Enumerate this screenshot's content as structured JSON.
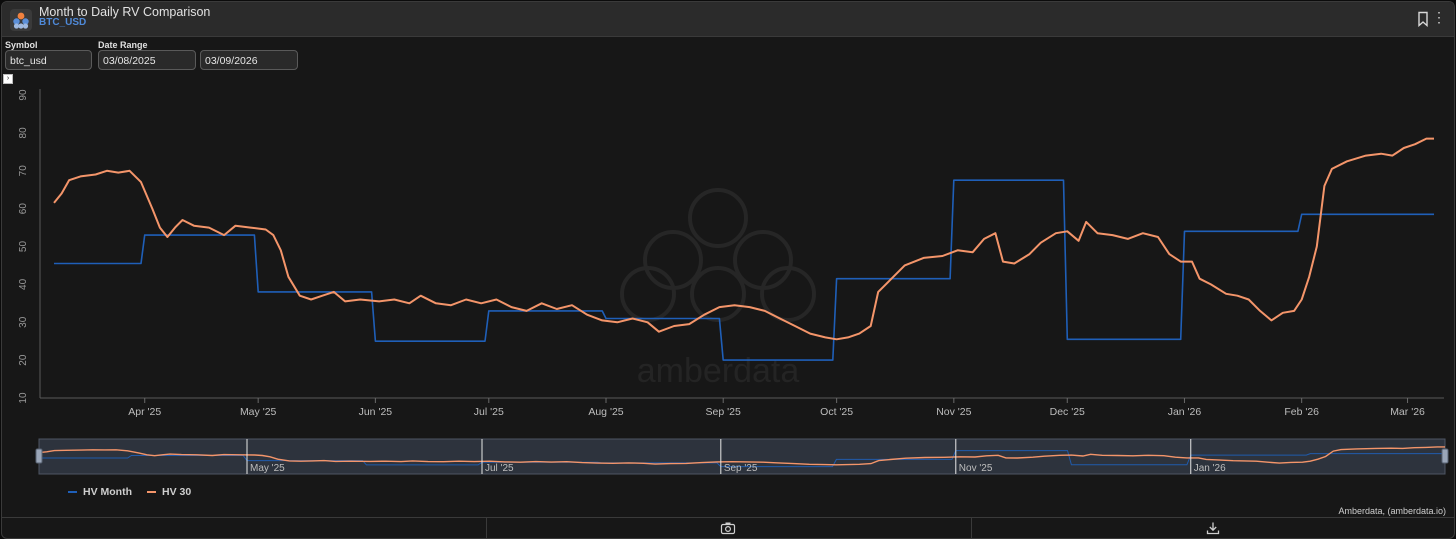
{
  "header": {
    "title": "Month to Daily RV Comparison",
    "subtitle": "BTC_USD"
  },
  "controls": {
    "symbol_label": "Symbol",
    "symbol_value": "btc_usd",
    "date_range_label": "Date Range",
    "date_start": "03/08/2025",
    "date_end": "03/09/2026"
  },
  "watermark": "amberdata",
  "credits": "Amberdata, (amberdata.io)",
  "colors": {
    "hv_month": "#1f5fb8",
    "hv_30": "#f4956a",
    "background": "#171717"
  },
  "icons": [
    "amberdata-logo-icon",
    "bookmark-icon",
    "more-vertical-icon",
    "camera-icon",
    "download-icon"
  ],
  "chart_data": {
    "type": "line",
    "title": "",
    "xlabel": "",
    "ylabel": "",
    "ylim": [
      10,
      90
    ],
    "y_ticks": [
      "10",
      "20",
      "30",
      "40",
      "50",
      "60",
      "70",
      "80",
      "90"
    ],
    "x_range": [
      "2025-03-08",
      "2026-03-08"
    ],
    "x_ticks": [
      {
        "date": "2025-04-01",
        "label": "Apr '25"
      },
      {
        "date": "2025-05-01",
        "label": "May '25"
      },
      {
        "date": "2025-06-01",
        "label": "Jun '25"
      },
      {
        "date": "2025-07-01",
        "label": "Jul '25"
      },
      {
        "date": "2025-08-01",
        "label": "Aug '25"
      },
      {
        "date": "2025-09-01",
        "label": "Sep '25"
      },
      {
        "date": "2025-10-01",
        "label": "Oct '25"
      },
      {
        "date": "2025-11-01",
        "label": "Nov '25"
      },
      {
        "date": "2025-12-01",
        "label": "Dec '25"
      },
      {
        "date": "2026-01-01",
        "label": "Jan '26"
      },
      {
        "date": "2026-02-01",
        "label": "Feb '26"
      },
      {
        "date": "2026-03-01",
        "label": "Mar '26"
      }
    ],
    "navigator_ticks": [
      "May '25",
      "Jul '25",
      "Sep '25",
      "Nov '25",
      "Jan '26"
    ],
    "legend_position": "bottom-left",
    "grid": false,
    "series": [
      {
        "name": "HV Month",
        "style": "step",
        "points": [
          [
            "2025-03-08",
            45.5
          ],
          [
            "2025-03-31",
            45.5
          ],
          [
            "2025-04-01",
            53
          ],
          [
            "2025-04-30",
            53
          ],
          [
            "2025-05-01",
            38
          ],
          [
            "2025-05-31",
            38
          ],
          [
            "2025-06-01",
            25
          ],
          [
            "2025-06-30",
            25
          ],
          [
            "2025-07-01",
            33
          ],
          [
            "2025-07-31",
            33
          ],
          [
            "2025-08-01",
            31
          ],
          [
            "2025-08-31",
            31
          ],
          [
            "2025-09-01",
            20
          ],
          [
            "2025-09-30",
            20
          ],
          [
            "2025-10-01",
            41.5
          ],
          [
            "2025-10-31",
            41.5
          ],
          [
            "2025-11-01",
            67.5
          ],
          [
            "2025-11-30",
            67.5
          ],
          [
            "2025-12-01",
            25.5
          ],
          [
            "2025-12-31",
            25.5
          ],
          [
            "2026-01-01",
            54
          ],
          [
            "2026-01-31",
            54
          ],
          [
            "2026-02-01",
            58.5
          ],
          [
            "2026-03-08",
            58.5
          ]
        ]
      },
      {
        "name": "HV 30",
        "style": "line",
        "points": [
          [
            "2025-03-08",
            61.5
          ],
          [
            "2025-03-10",
            64
          ],
          [
            "2025-03-12",
            67.5
          ],
          [
            "2025-03-15",
            68.5
          ],
          [
            "2025-03-19",
            69
          ],
          [
            "2025-03-22",
            70
          ],
          [
            "2025-03-25",
            69.5
          ],
          [
            "2025-03-28",
            70
          ],
          [
            "2025-03-31",
            67
          ],
          [
            "2025-04-03",
            60
          ],
          [
            "2025-04-05",
            55
          ],
          [
            "2025-04-07",
            52.5
          ],
          [
            "2025-04-09",
            55
          ],
          [
            "2025-04-11",
            57
          ],
          [
            "2025-04-14",
            55.5
          ],
          [
            "2025-04-18",
            55
          ],
          [
            "2025-04-22",
            53
          ],
          [
            "2025-04-25",
            55.5
          ],
          [
            "2025-04-29",
            55
          ],
          [
            "2025-05-03",
            54.5
          ],
          [
            "2025-05-05",
            53
          ],
          [
            "2025-05-07",
            49
          ],
          [
            "2025-05-09",
            42
          ],
          [
            "2025-05-12",
            37
          ],
          [
            "2025-05-15",
            36
          ],
          [
            "2025-05-18",
            37
          ],
          [
            "2025-05-21",
            38
          ],
          [
            "2025-05-24",
            35.5
          ],
          [
            "2025-05-28",
            36
          ],
          [
            "2025-06-02",
            35.5
          ],
          [
            "2025-06-06",
            36
          ],
          [
            "2025-06-10",
            35
          ],
          [
            "2025-06-13",
            37
          ],
          [
            "2025-06-17",
            35
          ],
          [
            "2025-06-21",
            34.5
          ],
          [
            "2025-06-25",
            36
          ],
          [
            "2025-06-29",
            35
          ],
          [
            "2025-07-03",
            36
          ],
          [
            "2025-07-07",
            34
          ],
          [
            "2025-07-11",
            33
          ],
          [
            "2025-07-15",
            35
          ],
          [
            "2025-07-19",
            33.5
          ],
          [
            "2025-07-23",
            34.5
          ],
          [
            "2025-07-27",
            32
          ],
          [
            "2025-07-31",
            30.5
          ],
          [
            "2025-08-04",
            30
          ],
          [
            "2025-08-08",
            31
          ],
          [
            "2025-08-12",
            30
          ],
          [
            "2025-08-15",
            27.5
          ],
          [
            "2025-08-19",
            29
          ],
          [
            "2025-08-23",
            29.5
          ],
          [
            "2025-08-27",
            32
          ],
          [
            "2025-08-31",
            34
          ],
          [
            "2025-09-04",
            34.5
          ],
          [
            "2025-09-08",
            34
          ],
          [
            "2025-09-12",
            33
          ],
          [
            "2025-09-16",
            31
          ],
          [
            "2025-09-20",
            29
          ],
          [
            "2025-09-24",
            27
          ],
          [
            "2025-09-28",
            26
          ],
          [
            "2025-10-01",
            25.5
          ],
          [
            "2025-10-04",
            26
          ],
          [
            "2025-10-07",
            27
          ],
          [
            "2025-10-10",
            29
          ],
          [
            "2025-10-12",
            38
          ],
          [
            "2025-10-15",
            41
          ],
          [
            "2025-10-19",
            45
          ],
          [
            "2025-10-24",
            47
          ],
          [
            "2025-10-29",
            47.5
          ],
          [
            "2025-11-02",
            49
          ],
          [
            "2025-11-06",
            48.5
          ],
          [
            "2025-11-09",
            52
          ],
          [
            "2025-11-12",
            53.5
          ],
          [
            "2025-11-14",
            46
          ],
          [
            "2025-11-17",
            45.5
          ],
          [
            "2025-11-21",
            48
          ],
          [
            "2025-11-24",
            51
          ],
          [
            "2025-11-28",
            53.5
          ],
          [
            "2025-12-01",
            54
          ],
          [
            "2025-12-04",
            51.5
          ],
          [
            "2025-12-06",
            56.5
          ],
          [
            "2025-12-09",
            53.5
          ],
          [
            "2025-12-13",
            53
          ],
          [
            "2025-12-17",
            52
          ],
          [
            "2025-12-21",
            53.5
          ],
          [
            "2025-12-25",
            52.5
          ],
          [
            "2025-12-28",
            48
          ],
          [
            "2025-12-31",
            46
          ],
          [
            "2026-01-03",
            46
          ],
          [
            "2026-01-05",
            41.5
          ],
          [
            "2026-01-08",
            40
          ],
          [
            "2026-01-12",
            37.5
          ],
          [
            "2026-01-15",
            37
          ],
          [
            "2026-01-18",
            36
          ],
          [
            "2026-01-21",
            33
          ],
          [
            "2026-01-24",
            30.5
          ],
          [
            "2026-01-27",
            32.5
          ],
          [
            "2026-01-30",
            33
          ],
          [
            "2026-02-01",
            36
          ],
          [
            "2026-02-03",
            42
          ],
          [
            "2026-02-05",
            50
          ],
          [
            "2026-02-07",
            66
          ],
          [
            "2026-02-09",
            70.5
          ],
          [
            "2026-02-13",
            72.5
          ],
          [
            "2026-02-18",
            74
          ],
          [
            "2026-02-22",
            74.5
          ],
          [
            "2026-02-25",
            74
          ],
          [
            "2026-02-28",
            76
          ],
          [
            "2026-03-03",
            77
          ],
          [
            "2026-03-06",
            78.5
          ],
          [
            "2026-03-08",
            78.5
          ]
        ]
      }
    ]
  }
}
